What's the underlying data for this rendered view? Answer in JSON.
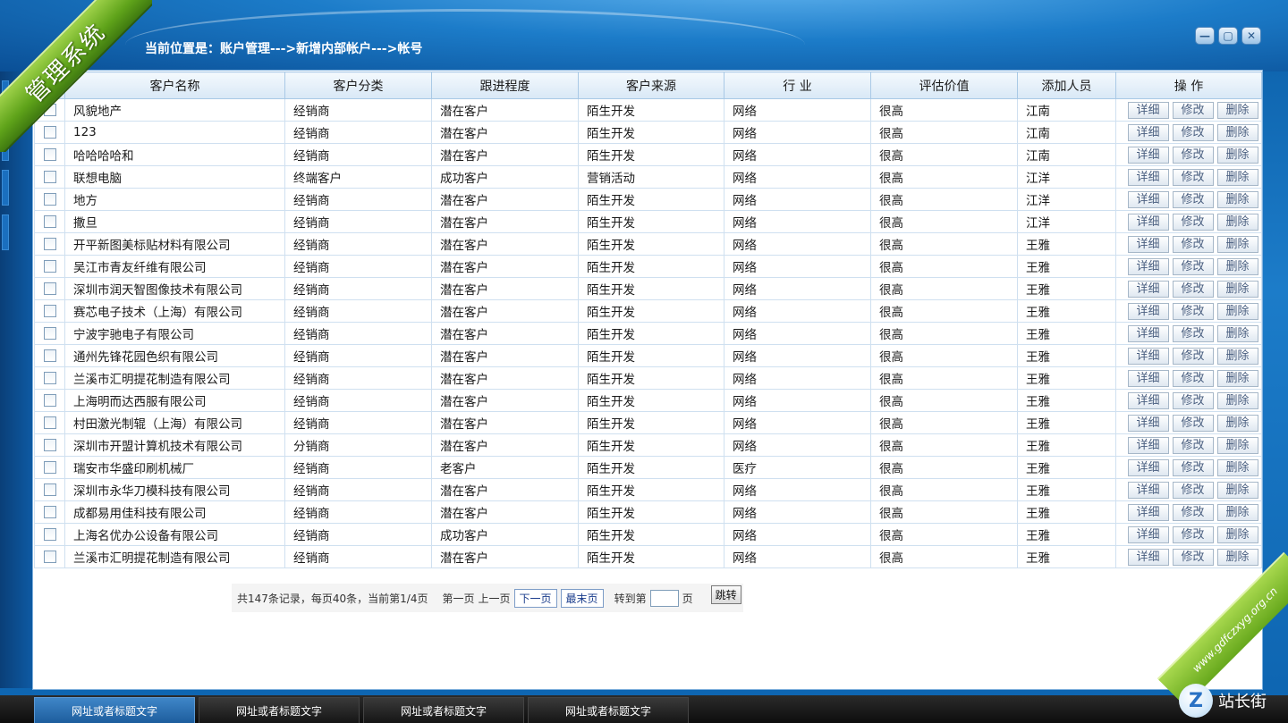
{
  "app": {
    "title": "管理系统",
    "breadcrumb": "当前位置是：账户管理--->新增内部帐户--->帐号",
    "window_controls": {
      "minimize": "—",
      "maximize": "▢",
      "close": "✕"
    }
  },
  "table": {
    "columns": [
      "客户名称",
      "客户分类",
      "跟进程度",
      "客户来源",
      "行 业",
      "评估价值",
      "添加人员",
      "操 作"
    ],
    "actions": {
      "detail": "详细",
      "edit": "修改",
      "delete": "删除"
    },
    "rows": [
      [
        "风貌地产",
        "经销商",
        "潜在客户",
        "陌生开发",
        "网络",
        "很高",
        "江南"
      ],
      [
        "123",
        "经销商",
        "潜在客户",
        "陌生开发",
        "网络",
        "很高",
        "江南"
      ],
      [
        "哈哈哈哈和",
        "经销商",
        "潜在客户",
        "陌生开发",
        "网络",
        "很高",
        "江南"
      ],
      [
        "联想电脑",
        "终端客户",
        "成功客户",
        "营销活动",
        "网络",
        "很高",
        "江洋"
      ],
      [
        "地方",
        "经销商",
        "潜在客户",
        "陌生开发",
        "网络",
        "很高",
        "江洋"
      ],
      [
        "撒旦",
        "经销商",
        "潜在客户",
        "陌生开发",
        "网络",
        "很高",
        "江洋"
      ],
      [
        "开平新图美标贴材料有限公司",
        "经销商",
        "潜在客户",
        "陌生开发",
        "网络",
        "很高",
        "王雅"
      ],
      [
        "吴江市青友纤维有限公司",
        "经销商",
        "潜在客户",
        "陌生开发",
        "网络",
        "很高",
        "王雅"
      ],
      [
        "深圳市润天智图像技术有限公司",
        "经销商",
        "潜在客户",
        "陌生开发",
        "网络",
        "很高",
        "王雅"
      ],
      [
        "赛芯电子技术（上海）有限公司",
        "经销商",
        "潜在客户",
        "陌生开发",
        "网络",
        "很高",
        "王雅"
      ],
      [
        "宁波宇驰电子有限公司",
        "经销商",
        "潜在客户",
        "陌生开发",
        "网络",
        "很高",
        "王雅"
      ],
      [
        "通州先锋花园色织有限公司",
        "经销商",
        "潜在客户",
        "陌生开发",
        "网络",
        "很高",
        "王雅"
      ],
      [
        "兰溪市汇明提花制造有限公司",
        "经销商",
        "潜在客户",
        "陌生开发",
        "网络",
        "很高",
        "王雅"
      ],
      [
        "上海明而达西服有限公司",
        "经销商",
        "潜在客户",
        "陌生开发",
        "网络",
        "很高",
        "王雅"
      ],
      [
        "村田激光制辊（上海）有限公司",
        "经销商",
        "潜在客户",
        "陌生开发",
        "网络",
        "很高",
        "王雅"
      ],
      [
        "深圳市开盟计算机技术有限公司",
        "分销商",
        "潜在客户",
        "陌生开发",
        "网络",
        "很高",
        "王雅"
      ],
      [
        "瑞安市华盛印刷机械厂",
        "经销商",
        "老客户",
        "陌生开发",
        "医疗",
        "很高",
        "王雅"
      ],
      [
        "深圳市永华刀模科技有限公司",
        "经销商",
        "潜在客户",
        "陌生开发",
        "网络",
        "很高",
        "王雅"
      ],
      [
        "成都易用佳科技有限公司",
        "经销商",
        "潜在客户",
        "陌生开发",
        "网络",
        "很高",
        "王雅"
      ],
      [
        "上海名优办公设备有限公司",
        "经销商",
        "成功客户",
        "陌生开发",
        "网络",
        "很高",
        "王雅"
      ],
      [
        "兰溪市汇明提花制造有限公司",
        "经销商",
        "潜在客户",
        "陌生开发",
        "网络",
        "很高",
        "王雅"
      ]
    ]
  },
  "pager": {
    "summary": "共147条记录，每页40条，当前第1/4页",
    "first": "第一页",
    "prev": "上一页",
    "next": "下一页",
    "last": "最末页",
    "goto_prefix": "转到第",
    "goto_suffix": "页",
    "goto_value": "",
    "jump": "跳转"
  },
  "badge": {
    "ribbon_text": "www.gdfczxyg.org.cn",
    "logo_letter": "Z",
    "logo_text": "站长街"
  },
  "taskbar": {
    "tabs": [
      "网址或者标题文字",
      "网址或者标题文字",
      "网址或者标题文字",
      "网址或者标题文字"
    ],
    "active_index": 0
  },
  "colors": {
    "background_blue": "#1c7cc9",
    "ribbon_green": "#5fa31a",
    "header_row": "#d8e8f6",
    "grid_border": "#cfe0f0"
  }
}
